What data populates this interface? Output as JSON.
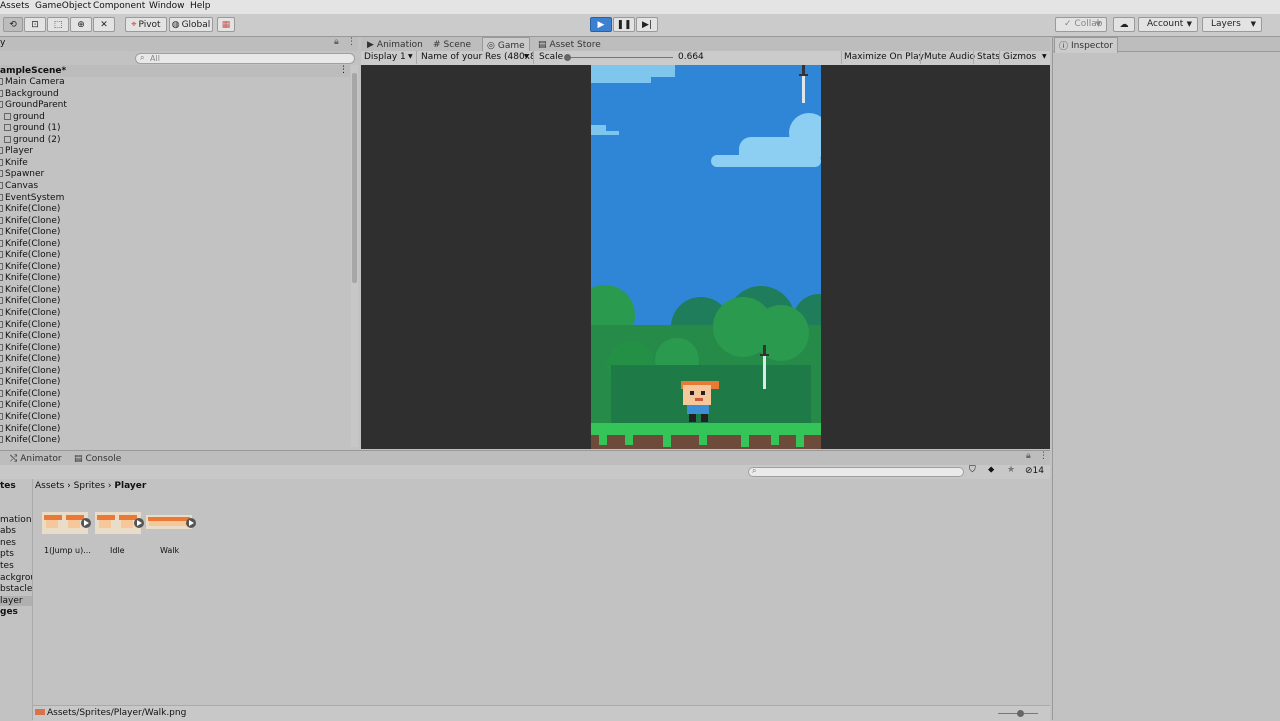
{
  "menubar": {
    "items": [
      "Assets",
      "GameObject",
      "Component",
      "Window",
      "Help"
    ]
  },
  "toolbar": {
    "pivot_label": "Pivot",
    "global_label": "Global",
    "collab_label": "Collab",
    "account_label": "Account",
    "layers_label": "Layers"
  },
  "hierarchy": {
    "tab_label": "y",
    "search_placeholder": "All",
    "scene_name": "ampleScene*",
    "items": [
      "Main Camera",
      "Background",
      "GroundParent",
      "ground",
      "ground (1)",
      "ground (2)",
      "Player",
      "Knife",
      "Spawner",
      "Canvas",
      "EventSystem",
      "Knife(Clone)",
      "Knife(Clone)",
      "Knife(Clone)",
      "Knife(Clone)",
      "Knife(Clone)",
      "Knife(Clone)",
      "Knife(Clone)",
      "Knife(Clone)",
      "Knife(Clone)",
      "Knife(Clone)",
      "Knife(Clone)",
      "Knife(Clone)",
      "Knife(Clone)",
      "Knife(Clone)",
      "Knife(Clone)",
      "Knife(Clone)",
      "Knife(Clone)",
      "Knife(Clone)",
      "Knife(Clone)",
      "Knife(Clone)",
      "Knife(Clone)"
    ]
  },
  "center_tabs": [
    "Animation",
    "Scene",
    "Game",
    "Asset Store"
  ],
  "game_bar": {
    "display": "Display 1",
    "resolution": "Name of your Res (480x8",
    "scale_label": "Scale",
    "scale_value": "0.664",
    "maximize": "Maximize On Play",
    "mute": "Mute Audio",
    "stats": "Stats",
    "gizmos": "Gizmos"
  },
  "inspector": {
    "tab_label": "Inspector"
  },
  "bottom_tabs": [
    "Animator",
    "Console"
  ],
  "project": {
    "breadcrumb": [
      "Assets",
      "Sprites",
      "Player"
    ],
    "visible_count": "14",
    "tree_label": "tes",
    "tree": [
      "",
      "mations",
      "abs",
      "nes",
      "pts",
      "tes",
      "ackgrou",
      "bstacles",
      "layer",
      "ges"
    ],
    "assets": [
      {
        "label": "1(Jump u)..."
      },
      {
        "label": "Idle"
      },
      {
        "label": "Walk"
      }
    ],
    "status_path": "Assets/Sprites/Player/Walk.png"
  },
  "colors": {
    "sky": "#2f86d6",
    "play": "#3d7fd0",
    "grass": "#2fba52"
  }
}
